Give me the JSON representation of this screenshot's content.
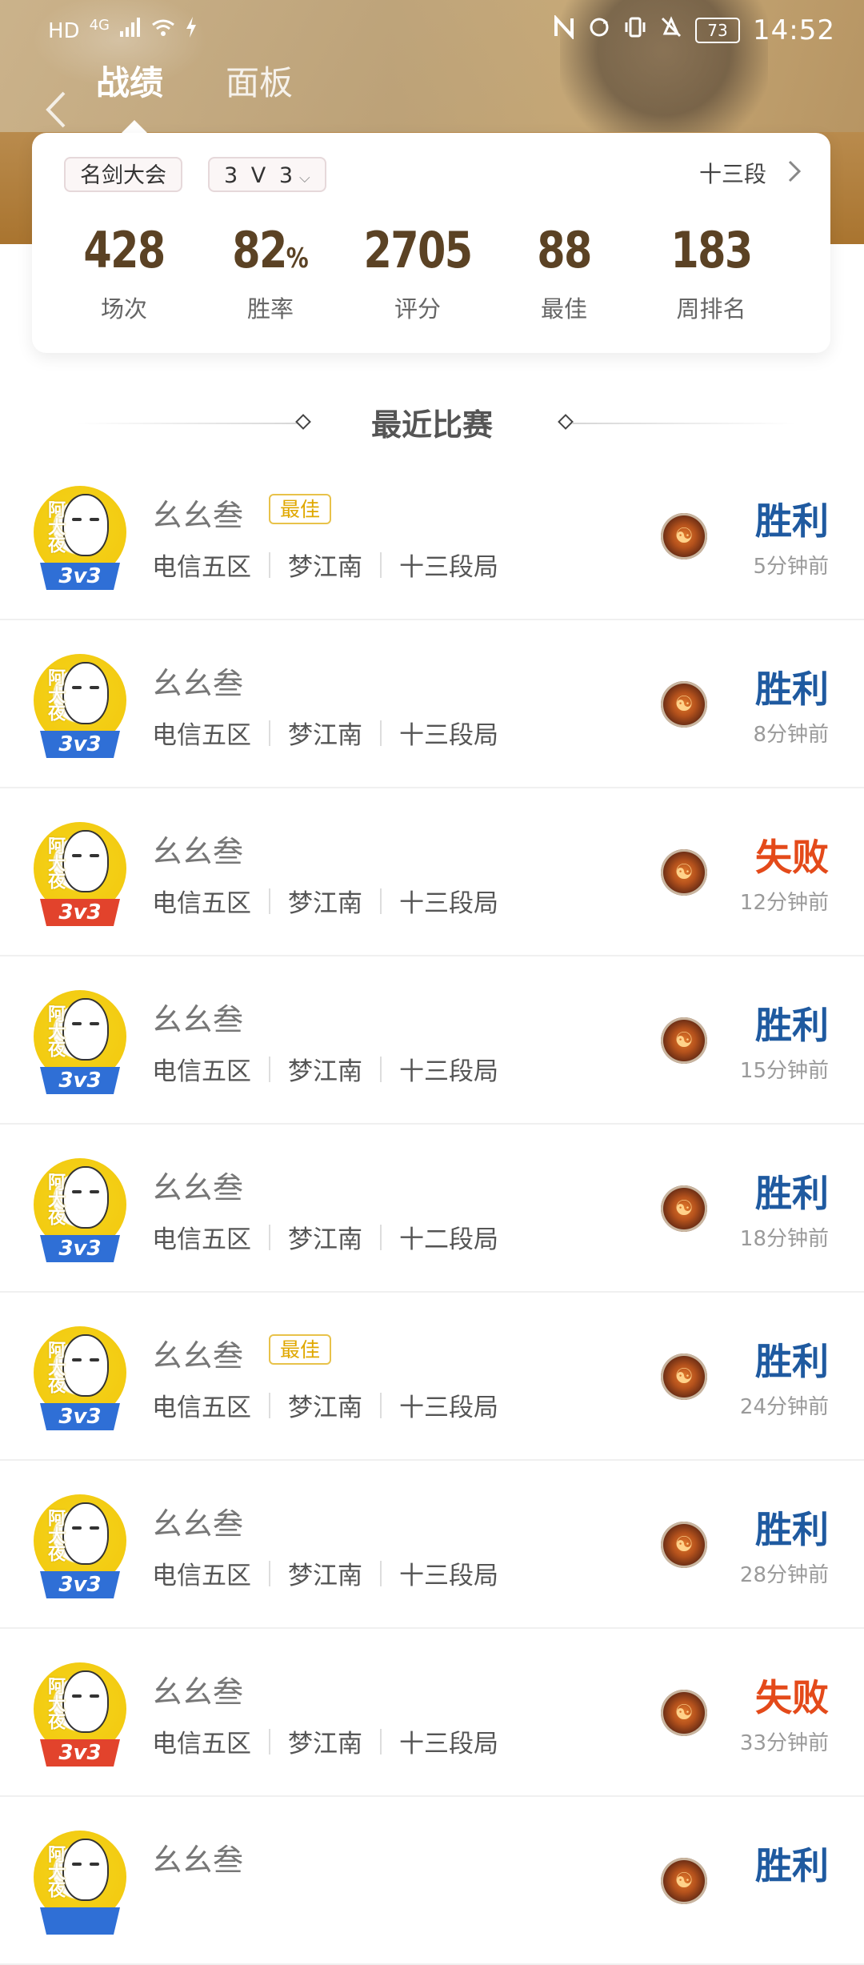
{
  "status_bar": {
    "hd": "HD",
    "network": "4G",
    "battery": "73",
    "time": "14:52"
  },
  "tabs": [
    {
      "label": "战绩",
      "active": true
    },
    {
      "label": "面板",
      "active": false
    }
  ],
  "filters": {
    "mode": "名剑大会",
    "type": "3 V 3",
    "rank": "十三段"
  },
  "stats": [
    {
      "value": "428",
      "unit": "",
      "label": "场次"
    },
    {
      "value": "82",
      "unit": "%",
      "label": "胜率"
    },
    {
      "value": "2705",
      "unit": "",
      "label": "评分"
    },
    {
      "value": "88",
      "unit": "",
      "label": "最佳"
    },
    {
      "value": "183",
      "unit": "",
      "label": "周排名"
    }
  ],
  "section_title": "最近比赛",
  "matches": [
    {
      "player": "幺幺叁",
      "best": "最佳",
      "server": "电信五区",
      "realm": "梦江南",
      "rank": "十三段局",
      "result": "胜利",
      "outcome": "win",
      "time": "5分钟前",
      "tag": "3v3"
    },
    {
      "player": "幺幺叁",
      "best": "",
      "server": "电信五区",
      "realm": "梦江南",
      "rank": "十三段局",
      "result": "胜利",
      "outcome": "win",
      "time": "8分钟前",
      "tag": "3v3"
    },
    {
      "player": "幺幺叁",
      "best": "",
      "server": "电信五区",
      "realm": "梦江南",
      "rank": "十三段局",
      "result": "失败",
      "outcome": "lose",
      "time": "12分钟前",
      "tag": "3v3"
    },
    {
      "player": "幺幺叁",
      "best": "",
      "server": "电信五区",
      "realm": "梦江南",
      "rank": "十三段局",
      "result": "胜利",
      "outcome": "win",
      "time": "15分钟前",
      "tag": "3v3"
    },
    {
      "player": "幺幺叁",
      "best": "",
      "server": "电信五区",
      "realm": "梦江南",
      "rank": "十二段局",
      "result": "胜利",
      "outcome": "win",
      "time": "18分钟前",
      "tag": "3v3"
    },
    {
      "player": "幺幺叁",
      "best": "最佳",
      "server": "电信五区",
      "realm": "梦江南",
      "rank": "十三段局",
      "result": "胜利",
      "outcome": "win",
      "time": "24分钟前",
      "tag": "3v3"
    },
    {
      "player": "幺幺叁",
      "best": "",
      "server": "电信五区",
      "realm": "梦江南",
      "rank": "十三段局",
      "result": "胜利",
      "outcome": "win",
      "time": "28分钟前",
      "tag": "3v3"
    },
    {
      "player": "幺幺叁",
      "best": "",
      "server": "电信五区",
      "realm": "梦江南",
      "rank": "十三段局",
      "result": "失败",
      "outcome": "lose",
      "time": "33分钟前",
      "tag": "3v3"
    },
    {
      "player": "幺幺叁",
      "best": "",
      "server": "",
      "realm": "",
      "rank": "",
      "result": "胜利",
      "outcome": "win",
      "time": "",
      "tag": ""
    }
  ],
  "colors": {
    "win": "#1f5aa0",
    "lose": "#e44a1a",
    "stat_number": "#5b4224",
    "win_tag": "#2f6fd6",
    "lose_tag": "#e2432c"
  },
  "icons": {
    "back": "chevron-left-icon",
    "rank_more": "chevron-right-icon",
    "hero": "hero-class-icon"
  }
}
